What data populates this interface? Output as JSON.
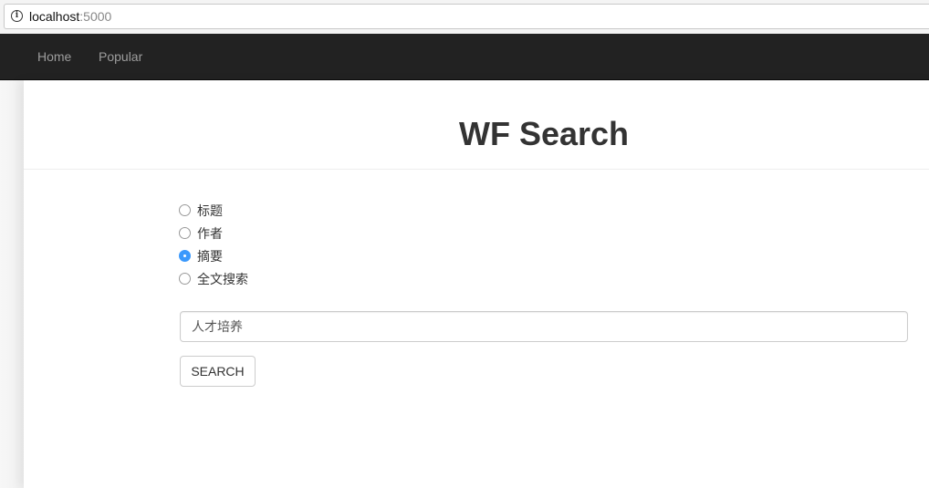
{
  "browser": {
    "url_host": "localhost",
    "url_port": ":5000",
    "info_icon": "info-icon"
  },
  "navbar": {
    "links": [
      {
        "label": "Home"
      },
      {
        "label": "Popular"
      }
    ]
  },
  "main": {
    "title": "WF Search",
    "search_options": [
      {
        "label": "标题",
        "checked": false
      },
      {
        "label": "作者",
        "checked": false
      },
      {
        "label": "摘要",
        "checked": true
      },
      {
        "label": "全文搜索",
        "checked": false
      }
    ],
    "search_input": {
      "value": "人才培养",
      "placeholder": ""
    },
    "search_button_label": "SEARCH"
  },
  "colors": {
    "navbar_bg": "#222222",
    "nav_link": "#9d9d9d",
    "radio_checked": "#3b99fc"
  }
}
